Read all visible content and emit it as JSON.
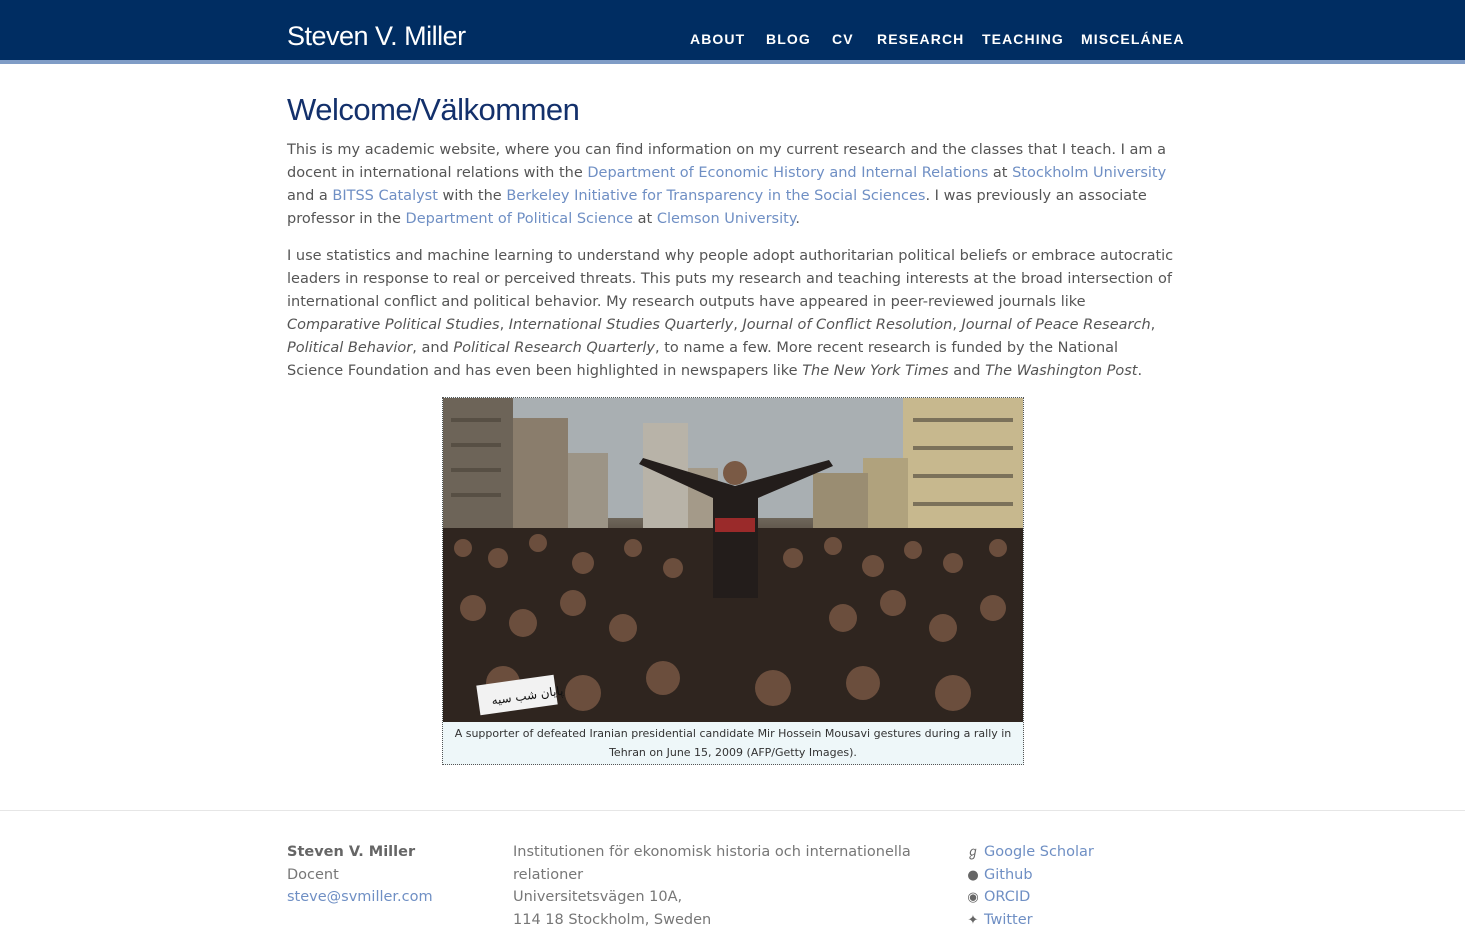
{
  "header": {
    "brand": "Steven V. Miller",
    "nav": [
      {
        "label": "ABOUT"
      },
      {
        "label": "BLOG"
      },
      {
        "label": "CV"
      },
      {
        "label": "RESEARCH"
      },
      {
        "label": "TEACHING"
      },
      {
        "label": "MISCELÁNEA"
      }
    ],
    "colors": {
      "navbar": "#002d62",
      "accent": "#7f9cc6",
      "title": "#13306b",
      "link": "#6f8fc4"
    }
  },
  "main": {
    "title": "Welcome/Välkommen",
    "p1": {
      "t1": "This is my academic website, where you can find information on my current research and the classes that I teach. I am a docent in international relations with the ",
      "l1": "Department of Economic History and Internal Relations",
      "t2": " at ",
      "l2": "Stockholm University",
      "t3": " and a ",
      "l3": "BITSS Catalyst",
      "t4": " with the ",
      "l4": "Berkeley Initiative for Transparency in the Social Sciences",
      "t5": ". I was previously an associate professor in the ",
      "l5": "Department of Political Science",
      "t6": " at ",
      "l6": "Clemson University",
      "t7": "."
    },
    "p2": {
      "t1": "I use statistics and machine learning to understand why people adopt authoritarian political beliefs or embrace autocratic leaders in response to real or perceived threats. This puts my research and teaching interests at the broad intersection of international conflict and political behavior. My research outputs have appeared in peer-reviewed journals like ",
      "j1": "Comparative Political Studies",
      "s1": ", ",
      "j2": "International Studies Quarterly",
      "s2": ", ",
      "j3": "Journal of Conflict Resolution",
      "s3": ", ",
      "j4": "Journal of Peace Research",
      "s4": ", ",
      "j5": "Political Behavior",
      "s5": ", and ",
      "j6": "Political Research Quarterly",
      "t2": ", to name a few. More recent research is funded by the National Science Foundation and has even been highlighted in newspapers like ",
      "n1": "The New York Times",
      "t3": " and ",
      "n2": "The Washington Post",
      "t4": "."
    },
    "figure": {
      "caption": "A supporter of defeated Iranian presidential candidate Mir Hossein Mousavi gestures during a rally in Tehran on June 15, 2009 (AFP/Getty Images).",
      "sign_text": "پایان شب سیه"
    }
  },
  "footer": {
    "name": "Steven V. Miller",
    "role": "Docent",
    "email": "steve@svmiller.com",
    "address": [
      "Institutionen för ekonomisk historia och internationella",
      "relationer",
      "Universitetsvägen 10A,",
      "114 18 Stockholm, Sweden"
    ],
    "links": [
      {
        "label": "Google Scholar",
        "icon": "google-scholar-icon"
      },
      {
        "label": "Github",
        "icon": "github-icon"
      },
      {
        "label": "ORCID",
        "icon": "orcid-icon"
      },
      {
        "label": "Twitter",
        "icon": "twitter-icon"
      }
    ]
  }
}
